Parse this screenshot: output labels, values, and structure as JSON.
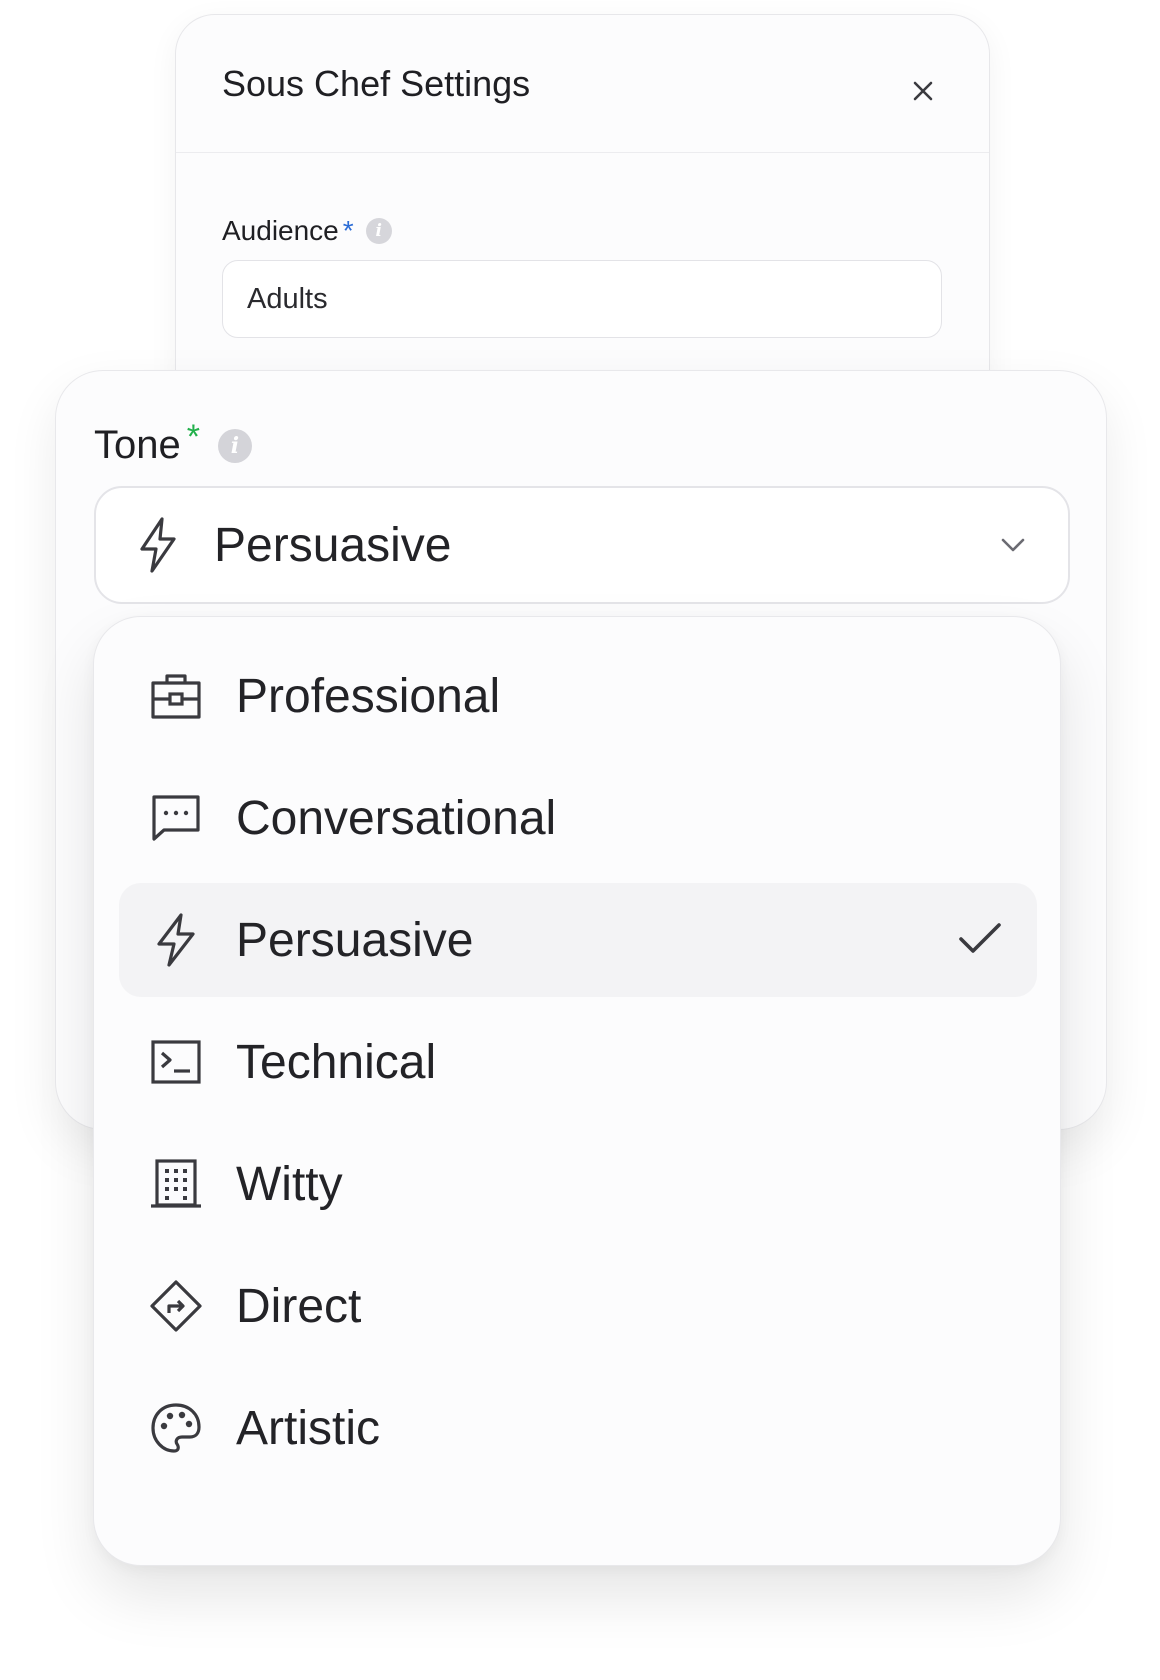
{
  "modal": {
    "title": "Sous Chef Settings",
    "close_icon": "close-icon",
    "audience": {
      "label": "Audience",
      "required_mark": "*",
      "info_icon": "info-icon",
      "value": "Adults"
    }
  },
  "tone": {
    "label": "Tone",
    "required_mark": "*",
    "info_icon": "info-icon",
    "selected": {
      "label": "Persuasive",
      "icon": "bolt-icon"
    },
    "chevron_icon": "chevron-down-icon",
    "options": [
      {
        "label": "Professional",
        "icon": "briefcase-icon",
        "selected": false
      },
      {
        "label": "Conversational",
        "icon": "chat-icon",
        "selected": false
      },
      {
        "label": "Persuasive",
        "icon": "bolt-icon",
        "selected": true
      },
      {
        "label": "Technical",
        "icon": "terminal-icon",
        "selected": false
      },
      {
        "label": "Witty",
        "icon": "building-icon",
        "selected": false
      },
      {
        "label": "Direct",
        "icon": "direction-sign-icon",
        "selected": false
      },
      {
        "label": "Artistic",
        "icon": "palette-icon",
        "selected": false
      }
    ]
  },
  "colors": {
    "required_blue": "#2b6cd6",
    "required_green": "#22b04b",
    "selected_row_bg": "#f3f3f5",
    "text": "#232327"
  }
}
